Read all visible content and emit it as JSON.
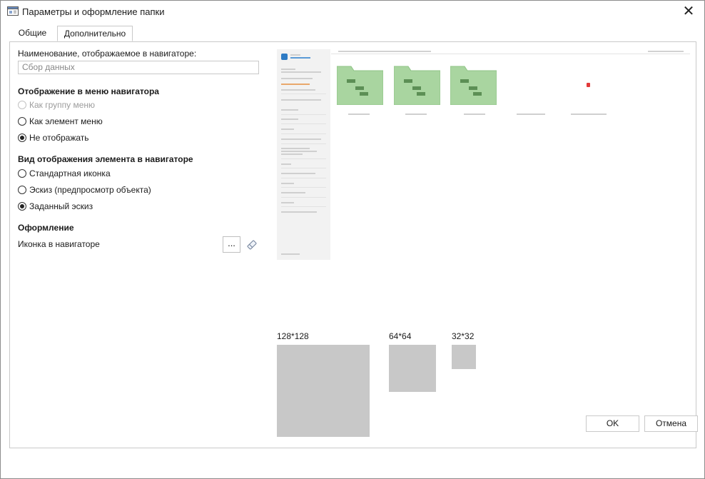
{
  "window": {
    "title": "Параметры и оформление папки",
    "close_glyph": "✕"
  },
  "tabs": [
    {
      "label": "Общие",
      "active": false
    },
    {
      "label": "Дополнительно",
      "active": true
    }
  ],
  "name_section": {
    "label": "Наименование, отображаемое в навигаторе:",
    "placeholder": "Сбор данных"
  },
  "menu_display": {
    "header": "Отображение в меню навигатора",
    "options": [
      {
        "label": "Как группу меню",
        "checked": false,
        "disabled": true
      },
      {
        "label": "Как элемент меню",
        "checked": false,
        "disabled": false
      },
      {
        "label": "Не отображать",
        "checked": true,
        "disabled": false
      }
    ]
  },
  "view_display": {
    "header": "Вид отображения элемента в навигаторе",
    "options": [
      {
        "label": "Стандартная иконка",
        "checked": false
      },
      {
        "label": "Эскиз (предпросмотр объекта)",
        "checked": false
      },
      {
        "label": "Заданный эскиз",
        "checked": true
      }
    ]
  },
  "design": {
    "header": "Оформление",
    "icon_label": "Иконка в навигаторе",
    "browse_label": "...",
    "clear_icon": "eraser-icon"
  },
  "preview": {
    "sizes": [
      "128*128",
      "64*64",
      "32*32"
    ],
    "folder_color": "#a9d5a0",
    "placeholder_color": "#c8c8c8"
  },
  "footer": {
    "ok_label": "OK",
    "cancel_label": "Отмена"
  }
}
